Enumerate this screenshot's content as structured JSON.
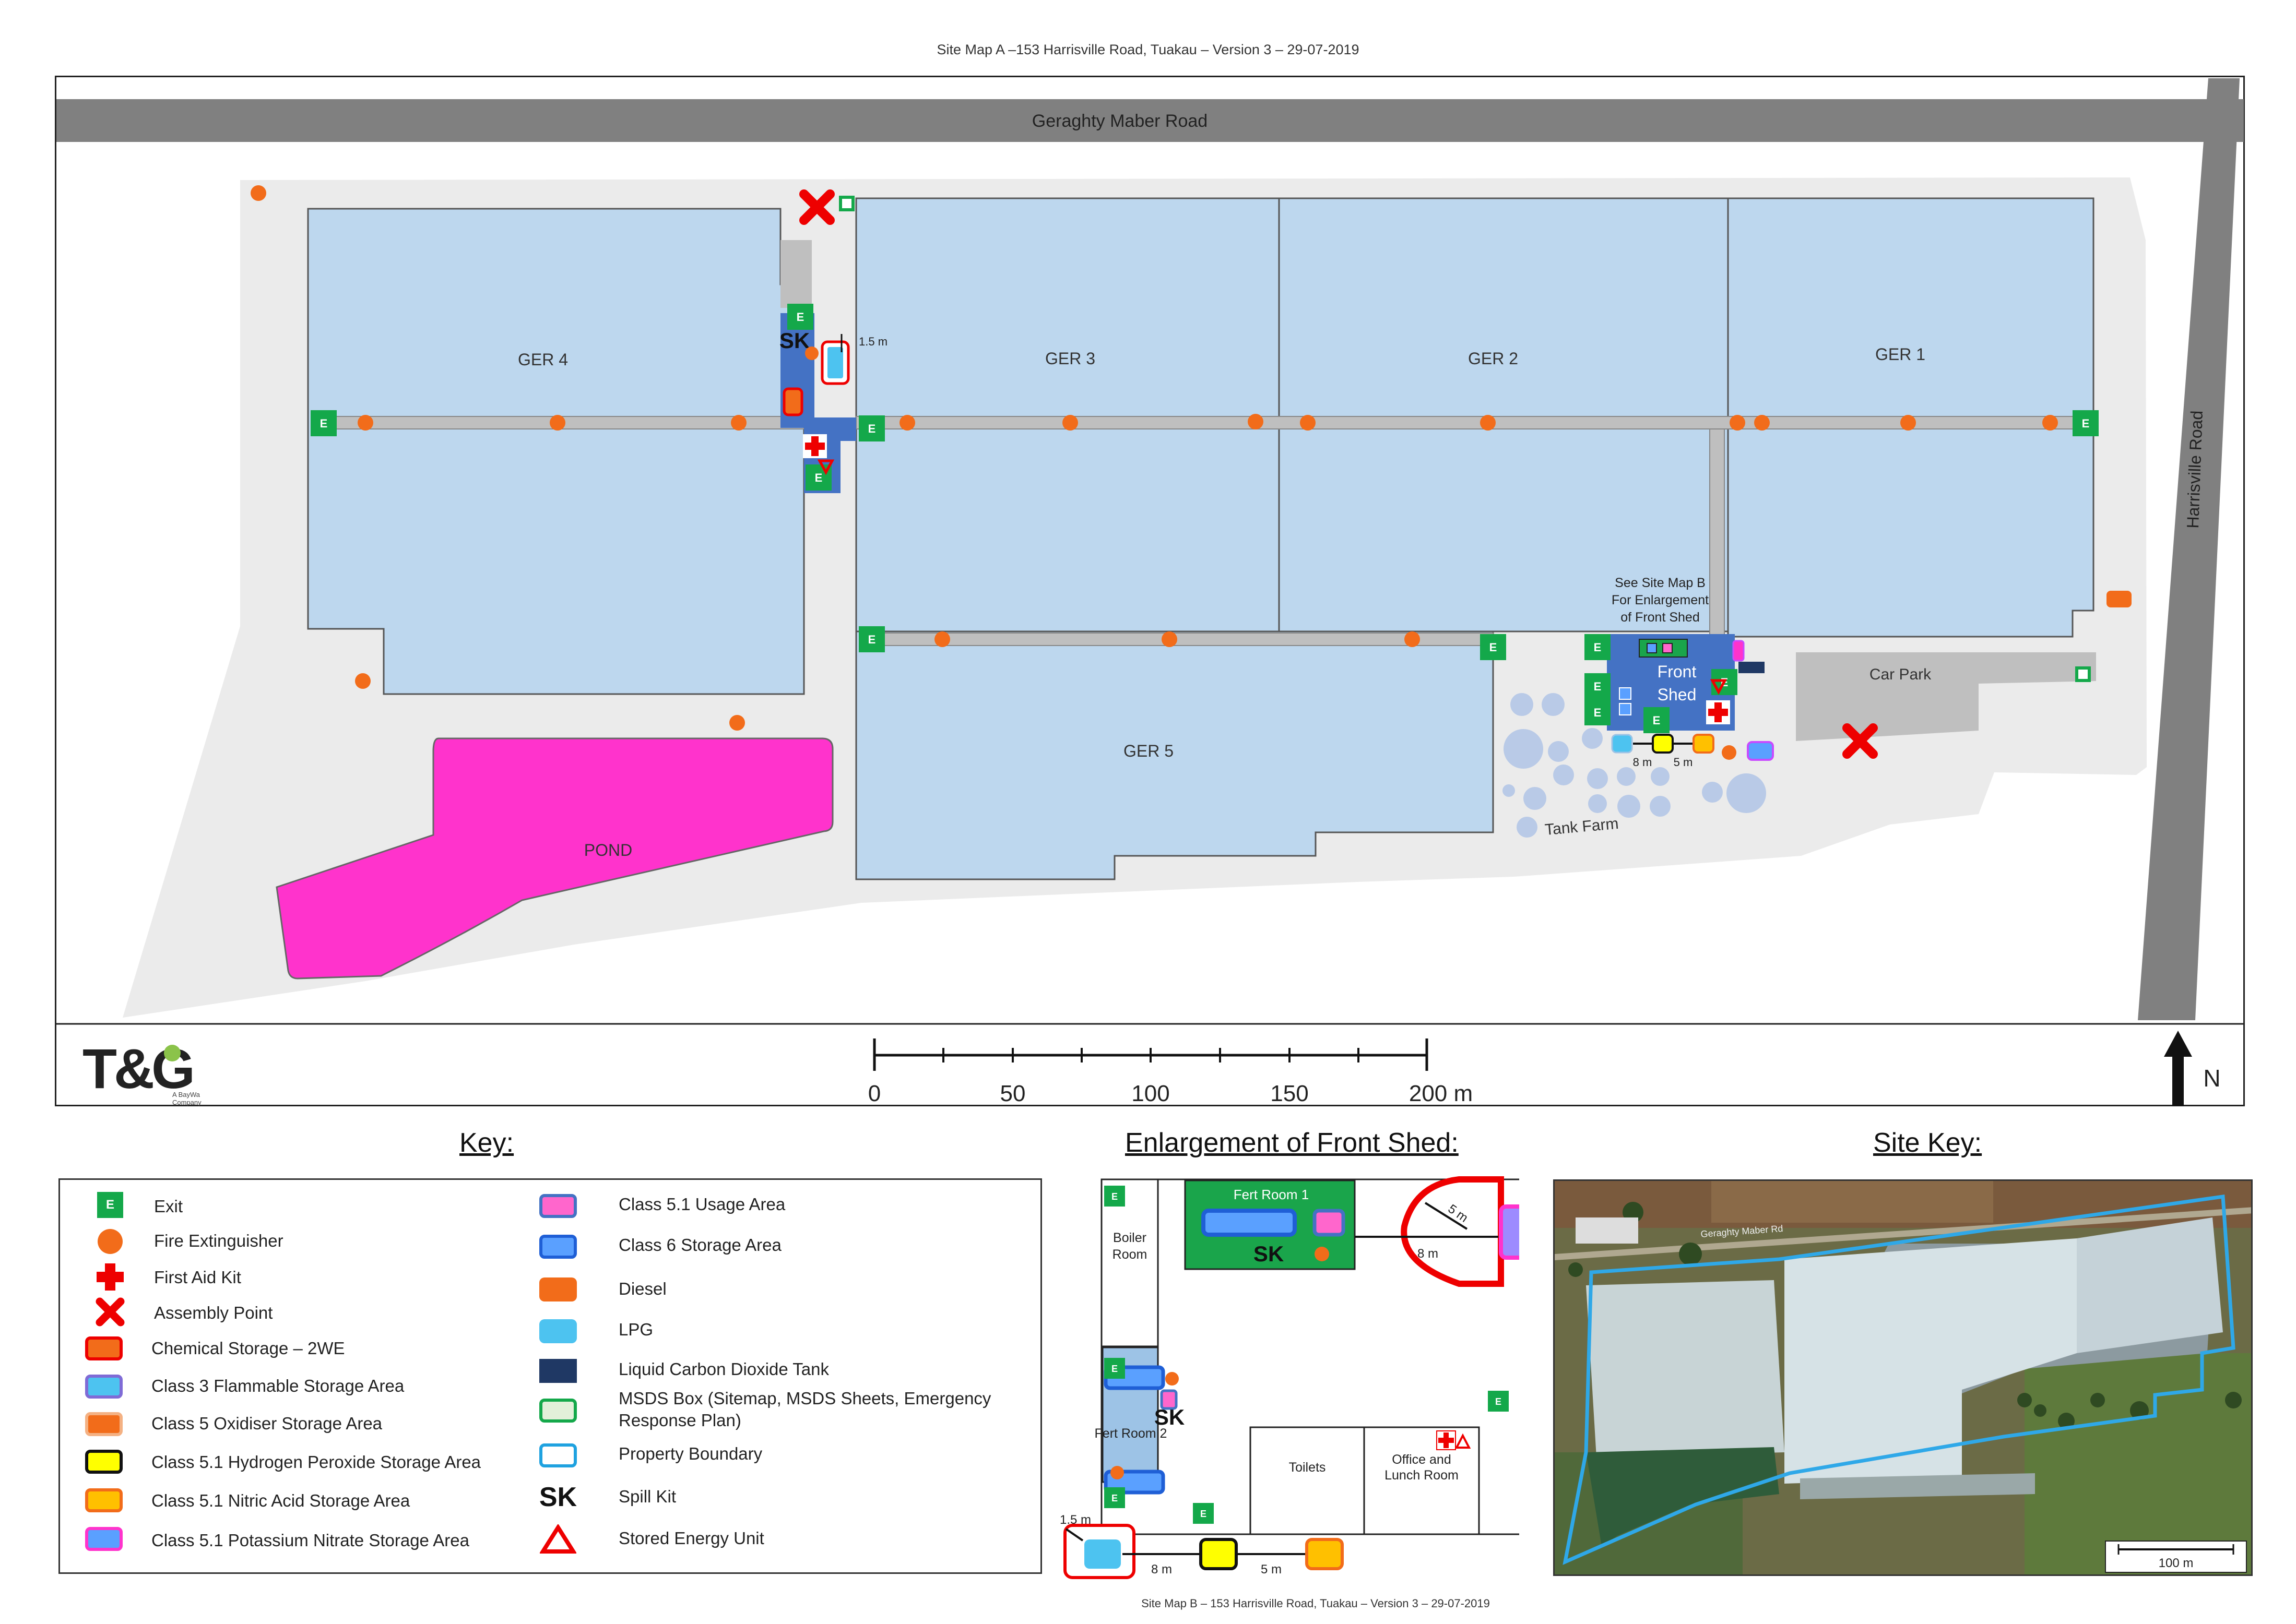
{
  "map_a": {
    "title": "Site Map A –153 Harrisville Road, Tuakau – Version 3 – 29-07-2019",
    "roads": {
      "north": "Geraghty Maber Road",
      "east": "Harrisville Road"
    },
    "greenhouses": [
      "GER 4",
      "GER 3",
      "GER 2",
      "GER 1",
      "GER 5"
    ],
    "pond": "POND",
    "front_shed": [
      "Front",
      "Shed"
    ],
    "see_map_b": [
      "See Site Map B",
      "For Enlargement",
      "of Front Shed"
    ],
    "car_park": "Car Park",
    "tank_farm": "Tank Farm",
    "exit_letter": "E",
    "spill_kit": "SK",
    "dist_15": "1.5 m",
    "dist_8": "8 m",
    "dist_5": "5 m",
    "north_label": "N",
    "scale": {
      "ticks": [
        "0",
        "50",
        "100",
        "150",
        "200 m"
      ]
    },
    "logo": {
      "text": "T&G",
      "sub": [
        "A BayWa",
        "Company"
      ]
    }
  },
  "key": {
    "title": "Key:",
    "items_left": [
      {
        "label": "Exit",
        "icon": "exit-icon"
      },
      {
        "label": "Fire Extinguisher",
        "icon": "fire-extinguisher-icon"
      },
      {
        "label": "First Aid Kit",
        "icon": "first-aid-icon"
      },
      {
        "label": "Assembly Point",
        "icon": "assembly-point-icon"
      },
      {
        "label": "Chemical Storage – 2WE",
        "icon": "chemical-storage-icon"
      },
      {
        "label": "Class 3 Flammable Storage Area",
        "icon": "class3-swatch"
      },
      {
        "label": "Class 5 Oxidiser Storage Area",
        "icon": "class5-swatch"
      },
      {
        "label": "Class 5.1 Hydrogen Peroxide Storage Area",
        "icon": "hydrogen-peroxide-swatch"
      },
      {
        "label": "Class 5.1 Nitric Acid Storage Area",
        "icon": "nitric-acid-swatch"
      },
      {
        "label": "Class 5.1 Potassium Nitrate Storage Area",
        "icon": "potassium-nitrate-swatch"
      }
    ],
    "items_right": [
      {
        "label": "Class 5.1 Usage Area",
        "icon": "usage-area-swatch"
      },
      {
        "label": "Class 6 Storage Area",
        "icon": "class6-swatch"
      },
      {
        "label": "Diesel",
        "icon": "diesel-swatch"
      },
      {
        "label": "LPG",
        "icon": "lpg-swatch"
      },
      {
        "label": "Liquid Carbon Dioxide Tank",
        "icon": "co2-tank-swatch"
      },
      {
        "label": "MSDS Box (Sitemap, MSDS Sheets, Emergency Response Plan)",
        "icon": "msds-box-swatch"
      },
      {
        "label": "Property Boundary",
        "icon": "property-boundary-swatch"
      },
      {
        "label": "Spill Kit",
        "icon": "spill-kit-icon"
      },
      {
        "label": "Stored Energy Unit",
        "icon": "stored-energy-icon"
      }
    ]
  },
  "enlargement": {
    "title": "Enlargement of Front Shed:",
    "fert_room_1": "Fert Room 1",
    "fert_room_2": "Fert Room 2",
    "boiler_room": [
      "Boiler",
      "Room"
    ],
    "toilets": "Toilets",
    "office": [
      "Office and",
      "Lunch Room"
    ],
    "dist_5": "5 m",
    "dist_8": "8 m",
    "dist_15": "1.5 m",
    "caption": "Site Map B – 153 Harrisville Road, Tuakau – Version 3 – 29-07-2019"
  },
  "site_key": {
    "title": "Site Key:",
    "road_label": "Geraghty Maber Rd",
    "scale_label": "100 m"
  },
  "colors": {
    "greenhouse": "#bdd7ee",
    "pond": "#ff33cc",
    "exit": "#14a84a",
    "extinguisher": "#f26c1a",
    "road": "#808080",
    "site": "#eeeeee",
    "shed": "#4472c4"
  }
}
